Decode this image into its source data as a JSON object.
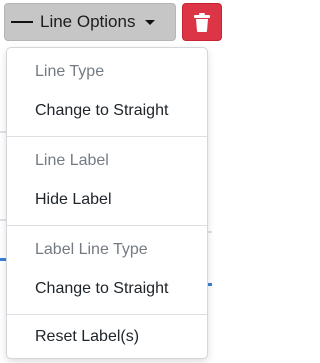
{
  "toolbar": {
    "line_options_label": "Line Options",
    "line_icon": "horizontal-line-icon",
    "caret_icon": "caret-down-icon",
    "delete_icon": "trash-icon",
    "delete_color": "#dc3545"
  },
  "menu": {
    "sections": [
      {
        "header": "Line Type",
        "item": "Change to Straight"
      },
      {
        "header": "Line Label",
        "item": "Hide Label"
      },
      {
        "header": "Label Line Type",
        "item": "Change to Straight"
      }
    ],
    "reset_label": "Reset Label(s)"
  }
}
